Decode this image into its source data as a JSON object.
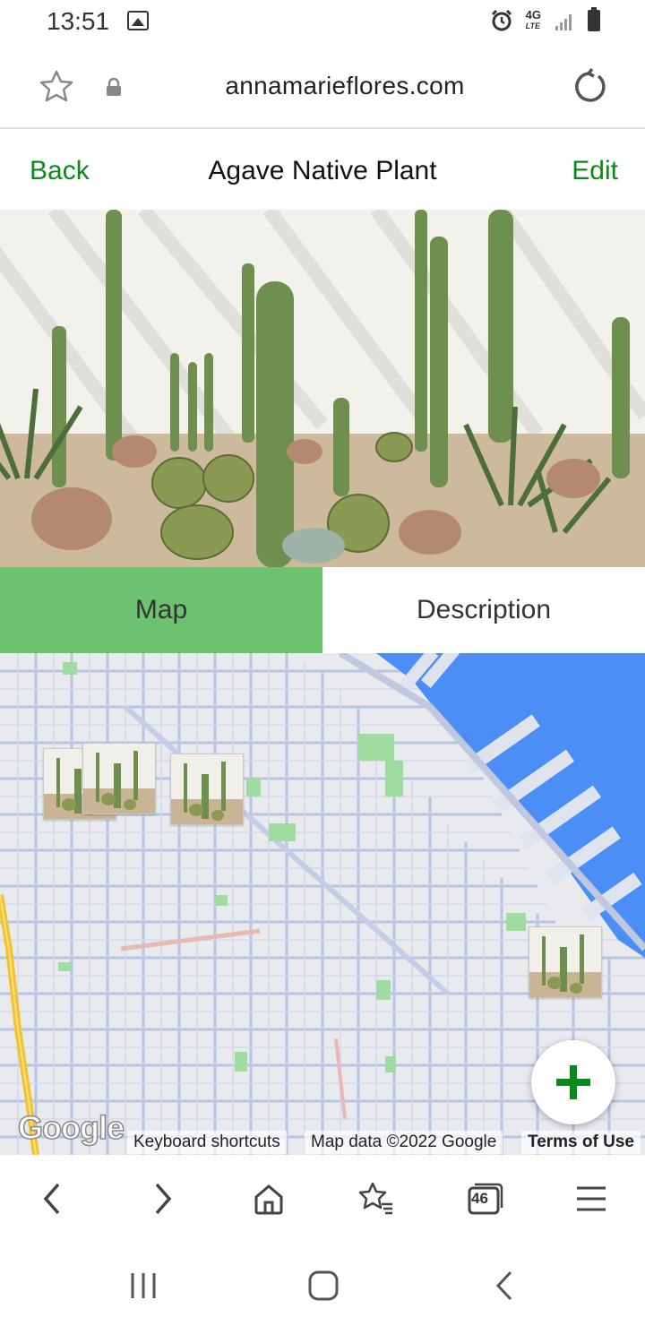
{
  "status_bar": {
    "time": "13:51",
    "network": "4G",
    "network_sub": "LTE"
  },
  "browser": {
    "url": "annamarieflores.com",
    "tab_count": "46"
  },
  "header": {
    "back_label": "Back",
    "title": "Agave Native Plant",
    "edit_label": "Edit"
  },
  "tabs": [
    {
      "label": "Map",
      "active": true
    },
    {
      "label": "Description",
      "active": false
    }
  ],
  "map": {
    "logo": "Google",
    "keyboard_shortcuts": "Keyboard shortcuts",
    "map_data": "Map data ©2022 Google",
    "terms": "Terms of Use"
  },
  "colors": {
    "accent": "#0a8a1a",
    "tab_active": "#6cc26e",
    "water": "#4b8ef5",
    "road": "#b8c4e4"
  },
  "icons": {
    "status": [
      "gallery-icon",
      "alarm-icon",
      "signal-icon",
      "battery-icon"
    ],
    "browser": [
      "star-icon",
      "lock-icon",
      "reload-icon"
    ],
    "toolbar": [
      "back-arrow-icon",
      "forward-arrow-icon",
      "home-icon",
      "bookmarks-icon",
      "tabs-icon",
      "menu-icon"
    ],
    "system": [
      "recents-icon",
      "home-icon",
      "back-icon"
    ],
    "fab": "plus-icon"
  }
}
